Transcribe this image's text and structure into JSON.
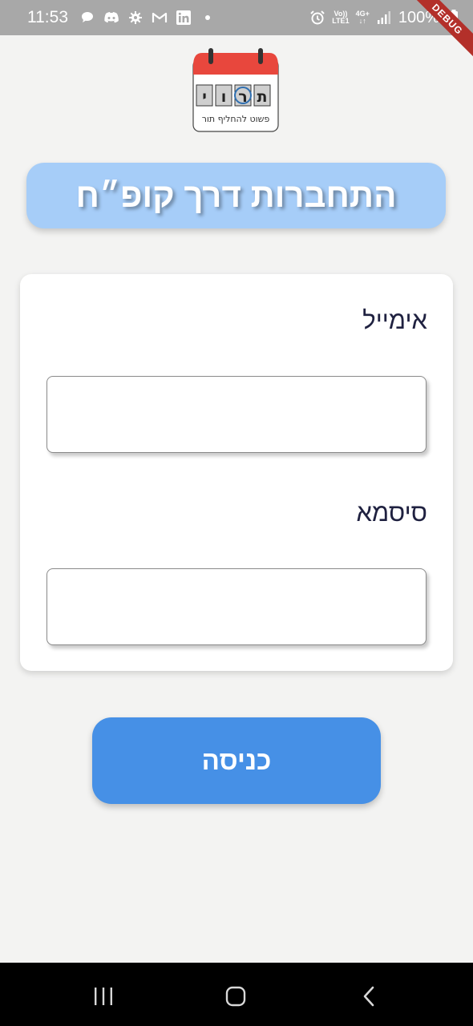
{
  "status_bar": {
    "time": "11:53",
    "network_top": "Vo))",
    "network_bottom": "LTE1",
    "signal_type": "4G+",
    "battery": "100%",
    "left_icons": [
      "chat-bubble-icon",
      "discord-icon",
      "settings-gear-icon",
      "gmail-icon",
      "linkedin-icon",
      "dot-icon"
    ],
    "right_icons": [
      "alarm-icon",
      "volte-icon",
      "signal-icon",
      "battery-icon"
    ]
  },
  "debug_banner": "DEBUG",
  "logo": {
    "letters": [
      "ת",
      "ו",
      "ר",
      "י"
    ],
    "tagline": "פשוט להחליף תור",
    "accent_color": "#e8473d"
  },
  "title": "התחברות דרך קופ״ח",
  "form": {
    "email_label": "אימייל",
    "email_value": "",
    "password_label": "סיסמא",
    "password_value": ""
  },
  "login_button": "כניסה",
  "colors": {
    "title_pill": "#a6cdf8",
    "button": "#4690e6",
    "background": "#f3f3f2",
    "label_text": "#1f2140"
  }
}
